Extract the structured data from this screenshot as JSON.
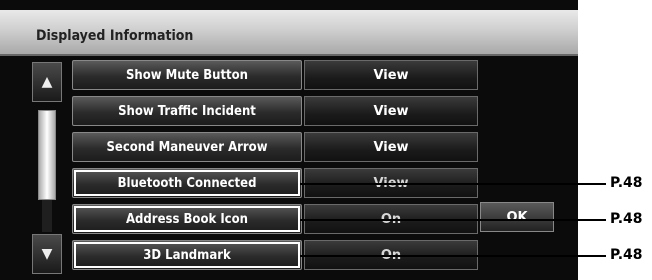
{
  "title": "Displayed Information",
  "rows": [
    {
      "label": "Show Mute Button",
      "value": "View"
    },
    {
      "label": "Show Traffic Incident",
      "value": "View"
    },
    {
      "label": "Second Maneuver Arrow",
      "value": "View"
    },
    {
      "label": "Bluetooth Connected",
      "value": "View"
    },
    {
      "label": "Address Book Icon",
      "value": "On"
    },
    {
      "label": "3D Landmark",
      "value": "On"
    }
  ],
  "ok_label": "OK",
  "page_refs": [
    "P.48",
    "P.48",
    "P.48"
  ],
  "icons": {
    "scroll_up": "scroll-up-icon",
    "scroll_down": "scroll-down-icon"
  }
}
